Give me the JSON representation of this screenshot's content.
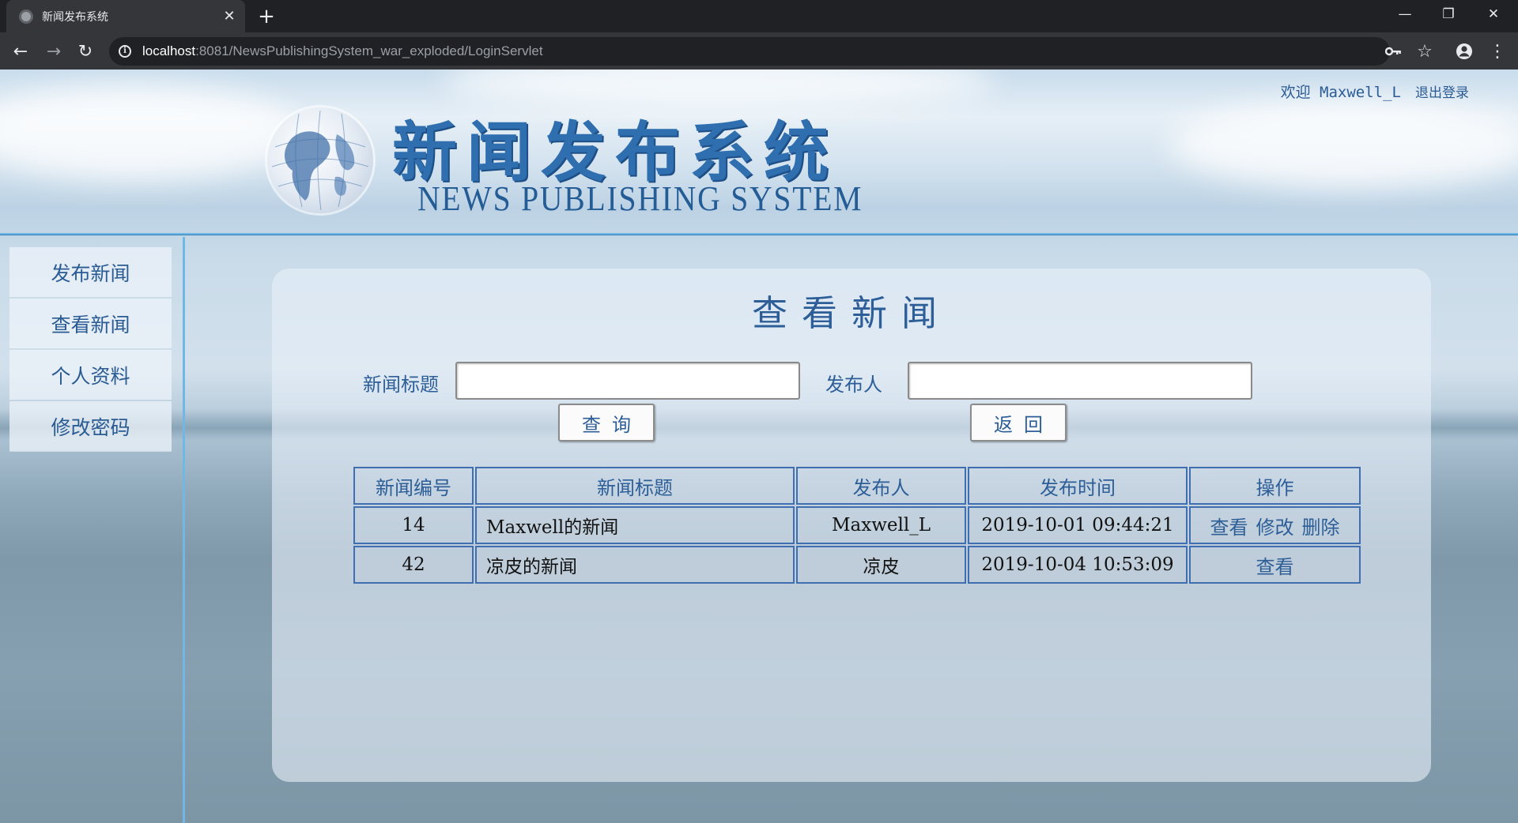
{
  "browser": {
    "tab_title": "新闻发布系统",
    "url_host": "localhost",
    "url_rest": ":8081/NewsPublishingSystem_war_exploded/LoginServlet"
  },
  "header": {
    "welcome": "欢迎",
    "username": "Maxwell_L",
    "logout": "退出登录",
    "logo_cn": "新闻发布系统",
    "logo_en": "NEWS PUBLISHING SYSTEM"
  },
  "sidebar": {
    "items": [
      {
        "label": "发布新闻"
      },
      {
        "label": "查看新闻"
      },
      {
        "label": "个人资料"
      },
      {
        "label": "修改密码"
      }
    ]
  },
  "main": {
    "title": "查看新闻",
    "search": {
      "title_label": "新闻标题",
      "title_value": "",
      "publisher_label": "发布人",
      "publisher_value": "",
      "query_button": "查询",
      "back_button": "返回"
    },
    "table": {
      "headers": [
        "新闻编号",
        "新闻标题",
        "发布人",
        "发布时间",
        "操作"
      ],
      "rows": [
        {
          "id": "14",
          "title": "Maxwell的新闻",
          "publisher": "Maxwell_L",
          "time": "2019-10-01 09:44:21",
          "actions": [
            "查看",
            "修改",
            "删除"
          ]
        },
        {
          "id": "42",
          "title": "凉皮的新闻",
          "publisher": "凉皮",
          "time": "2019-10-04 10:53:09",
          "actions": [
            "查看"
          ]
        }
      ]
    }
  },
  "colors": {
    "accent": "#2d5e98",
    "rule": "#6fb8e6",
    "table_border": "#3f6fb0"
  }
}
